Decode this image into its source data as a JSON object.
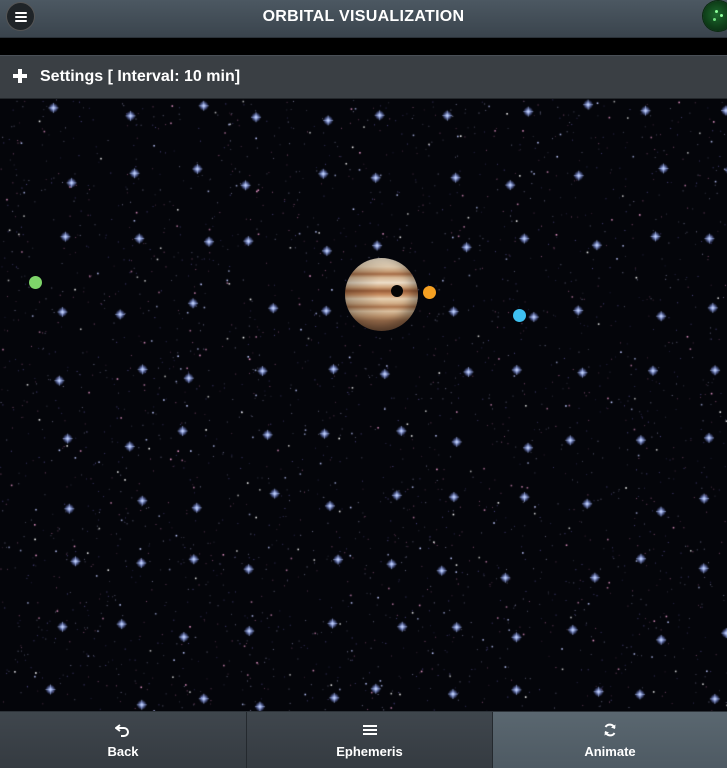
{
  "header": {
    "title": "ORBITAL VISUALIZATION",
    "menu_icon": "hamburger-menu-icon",
    "right_icon": "radar-icon"
  },
  "settings": {
    "label": "Settings [ Interval: 10 min]",
    "icon": "plus-icon"
  },
  "scene": {
    "planet": "Jupiter",
    "moons": [
      {
        "name": "io",
        "color": "#f5a022"
      },
      {
        "name": "europa",
        "color": "#3ec0f0"
      },
      {
        "name": "ganymede",
        "color": "#7ed46a"
      }
    ],
    "moon_shadow_color": "#050505"
  },
  "footer": {
    "buttons": [
      {
        "label": "Back",
        "icon": "undo-icon"
      },
      {
        "label": "Ephemeris",
        "icon": "list-icon"
      },
      {
        "label": "Animate",
        "icon": "refresh-icon",
        "active": true
      }
    ]
  },
  "colors": {
    "header_bg": "#434e57",
    "settings_bg": "#3a3f44",
    "space_bg": "#04050a",
    "active_tab": "#55626b"
  }
}
